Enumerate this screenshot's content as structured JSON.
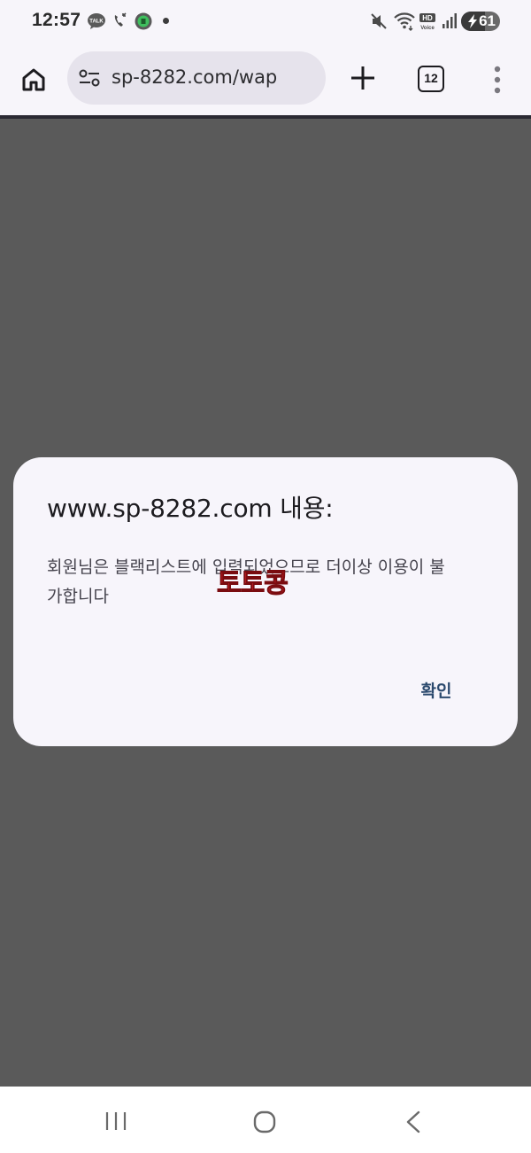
{
  "status_bar": {
    "time": "12:57",
    "left_icons": [
      "talk-icon",
      "call-icon",
      "ktalk-green-icon",
      "dot-icon"
    ],
    "right_icons": [
      "mute-icon",
      "wifi-icon",
      "hd-voice-icon",
      "signal-icon",
      "battery-icon"
    ],
    "battery_level": "61",
    "battery_fraction": 0.61
  },
  "toolbar": {
    "url": "sp-8282.com/wap",
    "tab_count": "12",
    "icons": [
      "home-icon",
      "site-settings-icon",
      "plus-icon",
      "tabs-icon",
      "more-vert-icon"
    ]
  },
  "dialog": {
    "title": "www.sp-8282.com 내용:",
    "message": "회원님은 블랙리스트에 입력되었으므로 더이상 이용이 불가합니다",
    "watermark": "토토콩",
    "confirm_label": "확인"
  },
  "colors": {
    "backdrop": "#5a5a5a",
    "dialog_bg": "#f7f5fb",
    "confirm_text": "#2c4a6e",
    "watermark": "#e8242a"
  },
  "nav_bar": {
    "icons": [
      "recent-apps-icon",
      "home-circle-icon",
      "back-icon"
    ]
  }
}
